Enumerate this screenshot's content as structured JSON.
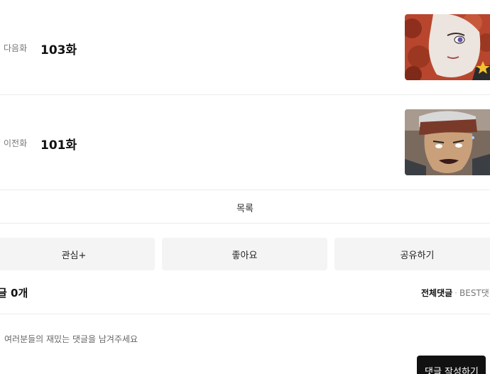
{
  "episodes": {
    "next": {
      "kind": "다음화",
      "title": "103화",
      "thumbnail": "red-haired-character-thumbnail"
    },
    "prev": {
      "kind": "이전화",
      "title": "101화",
      "thumbnail": "headband-warrior-thumbnail"
    }
  },
  "list_label": "목록",
  "actions": {
    "favorite": "관심+",
    "like": "좋아요",
    "share": "공유하기"
  },
  "comments": {
    "count_label": "글 0개",
    "sort_all": "전체댓글",
    "sort_best": "BEST댓",
    "input_placeholder": "여러분들의 재밌는 댓글을 남겨주세요",
    "write_button": "댓글 작성하기"
  },
  "colors": {
    "accent": "#111111",
    "button_bg": "#f4f4f4",
    "divider": "#ececec"
  }
}
